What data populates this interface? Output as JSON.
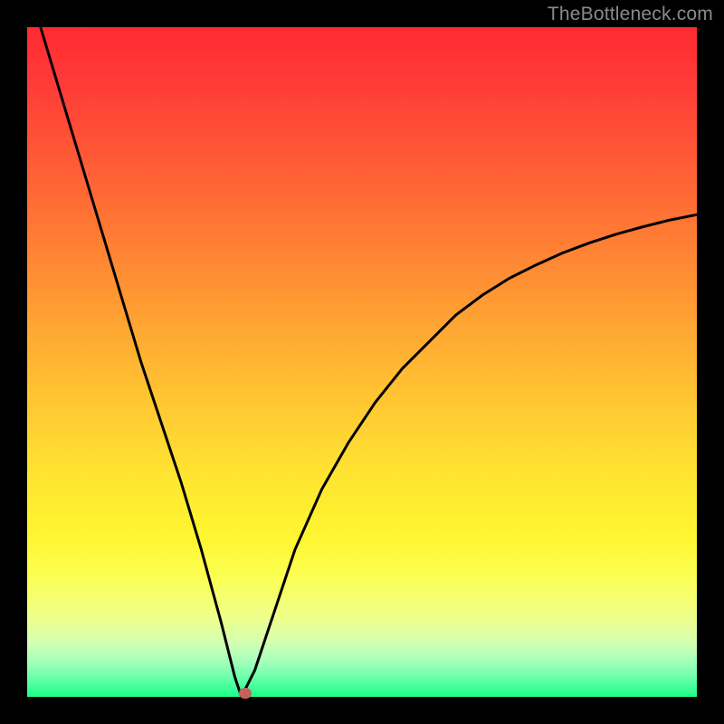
{
  "watermark": "TheBottleneck.com",
  "colors": {
    "background": "#000000",
    "gradient_top": "#ff2a30",
    "gradient_mid": "#ffe231",
    "gradient_bottom": "#1aff86",
    "curve": "#000000",
    "marker": "#c2635c",
    "watermark_text": "#8a8a8a"
  },
  "chart_data": {
    "type": "line",
    "title": "",
    "xlabel": "",
    "ylabel": "",
    "xlim": [
      0,
      100
    ],
    "ylim": [
      0,
      100
    ],
    "notes": "Background is a vertical color gradient from red (y=100) through orange/yellow to green (y=0). Curve touches y=0 near x≈32; small reddish marker sits at the cusp.",
    "series": [
      {
        "name": "bottleneck-curve",
        "x": [
          2,
          5,
          8,
          11,
          14,
          17,
          20,
          23,
          26,
          29,
          31,
          32,
          34,
          37,
          40,
          44,
          48,
          52,
          56,
          60,
          64,
          68,
          72,
          76,
          80,
          84,
          88,
          92,
          96,
          100
        ],
        "values": [
          100,
          90,
          80,
          70,
          60,
          50,
          41,
          32,
          22,
          11,
          3,
          0,
          4,
          13,
          22,
          31,
          38,
          44,
          49,
          53,
          57,
          60,
          62.5,
          64.5,
          66.3,
          67.8,
          69.1,
          70.2,
          71.2,
          72.0
        ]
      }
    ],
    "marker": {
      "x": 32.5,
      "y": 0.5
    }
  }
}
